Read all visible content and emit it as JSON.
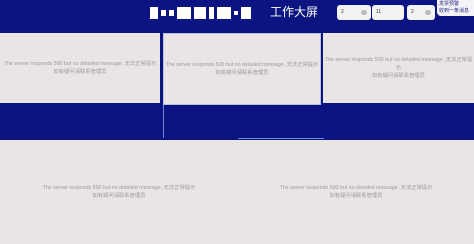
{
  "header": {
    "title_suffix": "工作大屏",
    "selects": [
      {
        "value": "2"
      },
      {
        "value": "11"
      },
      {
        "value": "2"
      }
    ],
    "notice": {
      "line1": "发票预警",
      "line2": "收到一条消息"
    }
  },
  "panels": {
    "message_line1": "The server responds 500 but no detailed message ,无法正常提示",
    "message_line2": "如有疑问请联系管理员"
  },
  "colors": {
    "background": "#0b1480",
    "panel": "#e9e5e5",
    "message_text": "#9a9aa4"
  }
}
